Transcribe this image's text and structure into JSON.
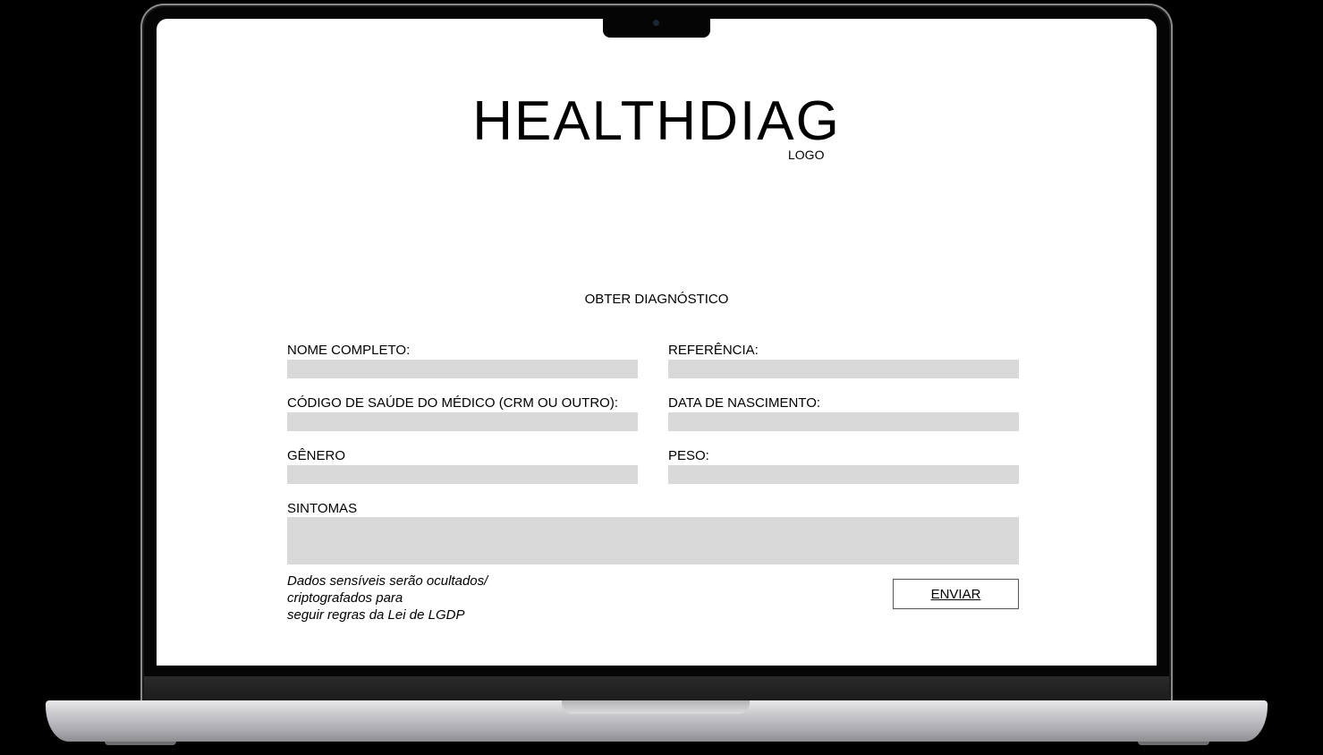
{
  "brand": {
    "title": "HEALTHDIAG",
    "subtitle": "LOGO"
  },
  "form": {
    "title": "OBTER DIAGNÓSTICO",
    "fields": {
      "nome_completo": {
        "label": "NOME COMPLETO:",
        "value": ""
      },
      "referencia": {
        "label": "REFERÊNCIA:",
        "value": ""
      },
      "codigo_medico": {
        "label": "CÓDIGO DE SAÚDE DO MÉDICO (CRM OU OUTRO):",
        "value": ""
      },
      "data_nascimento": {
        "label": "DATA DE NASCIMENTO:",
        "value": ""
      },
      "genero": {
        "label": "GÊNERO",
        "value": ""
      },
      "peso": {
        "label": "PESO:",
        "value": ""
      },
      "sintomas": {
        "label": "SINTOMAS",
        "value": ""
      }
    },
    "privacy_note": {
      "line1": "Dados sensíveis serão ocultados/",
      "line2": "criptografados para",
      "line3": "seguir regras da Lei de LGDP"
    },
    "submit_label": "ENVIAR"
  }
}
